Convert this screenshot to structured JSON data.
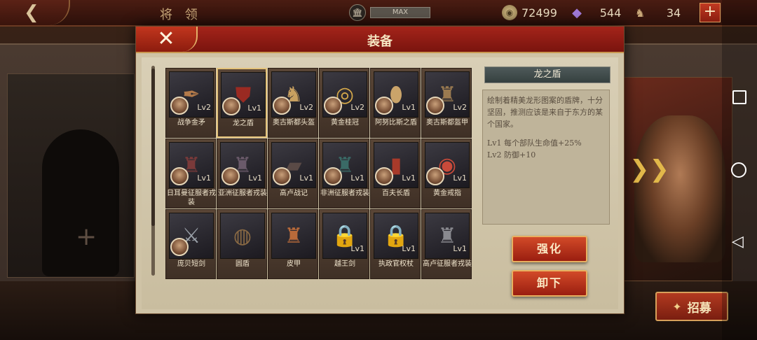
{
  "topbar": {
    "back_icon": "back-arrow-icon",
    "title": "将 领",
    "max_label": "MAX",
    "coins": "72499",
    "gems": "544",
    "troops": "34",
    "plus": "+"
  },
  "modal": {
    "title": "装备",
    "close_symbol": "✕"
  },
  "items": [
    {
      "name": "战争金矛",
      "lv": "Lv2",
      "icon": "✒",
      "color": "#b37a4a"
    },
    {
      "name": "龙之盾",
      "lv": "Lv1",
      "icon": "⛊",
      "color": "#9a2a22"
    },
    {
      "name": "奥古斯都头盔",
      "lv": "Lv2",
      "icon": "♞",
      "color": "#c8a060"
    },
    {
      "name": "黄金桂冠",
      "lv": "Lv2",
      "icon": "◎",
      "color": "#d4a84a"
    },
    {
      "name": "阿努比斯之盾",
      "lv": "Lv1",
      "icon": "⬮",
      "color": "#caa46a"
    },
    {
      "name": "奥古斯都盔甲",
      "lv": "Lv2",
      "icon": "♜",
      "color": "#9a7a50"
    },
    {
      "name": "日耳曼征服者戎装",
      "lv": "Lv1",
      "icon": "♜",
      "color": "#7a3a3a"
    },
    {
      "name": "亚洲征服者戎装",
      "lv": "Lv1",
      "icon": "♜",
      "color": "#6a5a6a"
    },
    {
      "name": "高卢战记",
      "lv": "Lv1",
      "icon": "▰",
      "color": "#5a4a46"
    },
    {
      "name": "非洲征服者戎装",
      "lv": "Lv1",
      "icon": "♜",
      "color": "#3a6a66"
    },
    {
      "name": "百夫长盾",
      "lv": "Lv1",
      "icon": "▮",
      "color": "#a83a2a"
    },
    {
      "name": "黄金戒指",
      "lv": "Lv1",
      "icon": "◉",
      "color": "#c84a3a"
    },
    {
      "name": "庞贝短剑",
      "lv": "",
      "icon": "⚔",
      "color": "#9aa0a8"
    },
    {
      "name": "圆盾",
      "lv": "",
      "icon": "◍",
      "color": "#8a6a44"
    },
    {
      "name": "皮甲",
      "lv": "",
      "icon": "♜",
      "color": "#b86a3a"
    },
    {
      "name": "越王剑",
      "lv": "Lv1",
      "icon": "🔒",
      "color": "#d8d0c0"
    },
    {
      "name": "执政官权杖",
      "lv": "Lv1",
      "icon": "🔒",
      "color": "#d8d0c0"
    },
    {
      "name": "高卢征服者戎装",
      "lv": "Lv1",
      "icon": "♜",
      "color": "#8a8a90"
    }
  ],
  "portraits_shown": [
    true,
    true,
    true,
    true,
    true,
    true,
    true,
    true,
    true,
    true,
    true,
    true,
    true,
    false,
    false,
    false,
    false,
    false
  ],
  "selected_index": 1,
  "detail": {
    "title": "龙之盾",
    "description": "绘制着精美龙形图案的盾牌，十分坚固，推测应该是来自于东方的某个国家。",
    "effects": [
      "Lv1  每个部队生命值+25%",
      "Lv2  防御+10"
    ]
  },
  "buttons": {
    "upgrade": "强化",
    "unequip": "卸下"
  },
  "background": {
    "plus": "+",
    "next_arrow": "❯❯",
    "recruit_label": "招募"
  },
  "colors": {
    "accent_red": "#a4241a",
    "gold_border": "#e3c27a"
  }
}
